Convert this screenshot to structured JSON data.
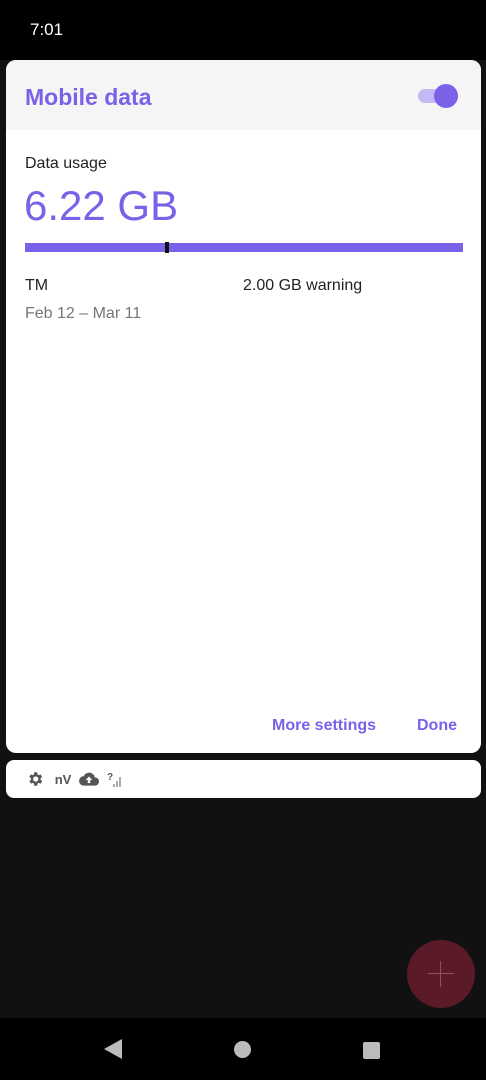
{
  "status_bar": {
    "time": "7:01"
  },
  "panel": {
    "title": "Mobile data",
    "toggle_on": true,
    "usage_label": "Data usage",
    "usage_value": "6.22 GB",
    "usage_warning_fraction": 0.32,
    "carrier": "TM",
    "warning_text": "2.00 GB warning",
    "period": "Feb 12 – Mar 11",
    "more_settings_label": "More settings",
    "done_label": "Done"
  },
  "quick_settings": {
    "icons": [
      "gear-icon",
      "nv-icon",
      "cloud-upload-icon",
      "signal-unknown-icon"
    ],
    "nv_label": "nV"
  },
  "colors": {
    "accent": "#7a61e8",
    "background": "#000000",
    "panel": "#ffffff"
  },
  "fab_icon": "plus-icon",
  "nav": [
    "back",
    "home",
    "recents"
  ]
}
